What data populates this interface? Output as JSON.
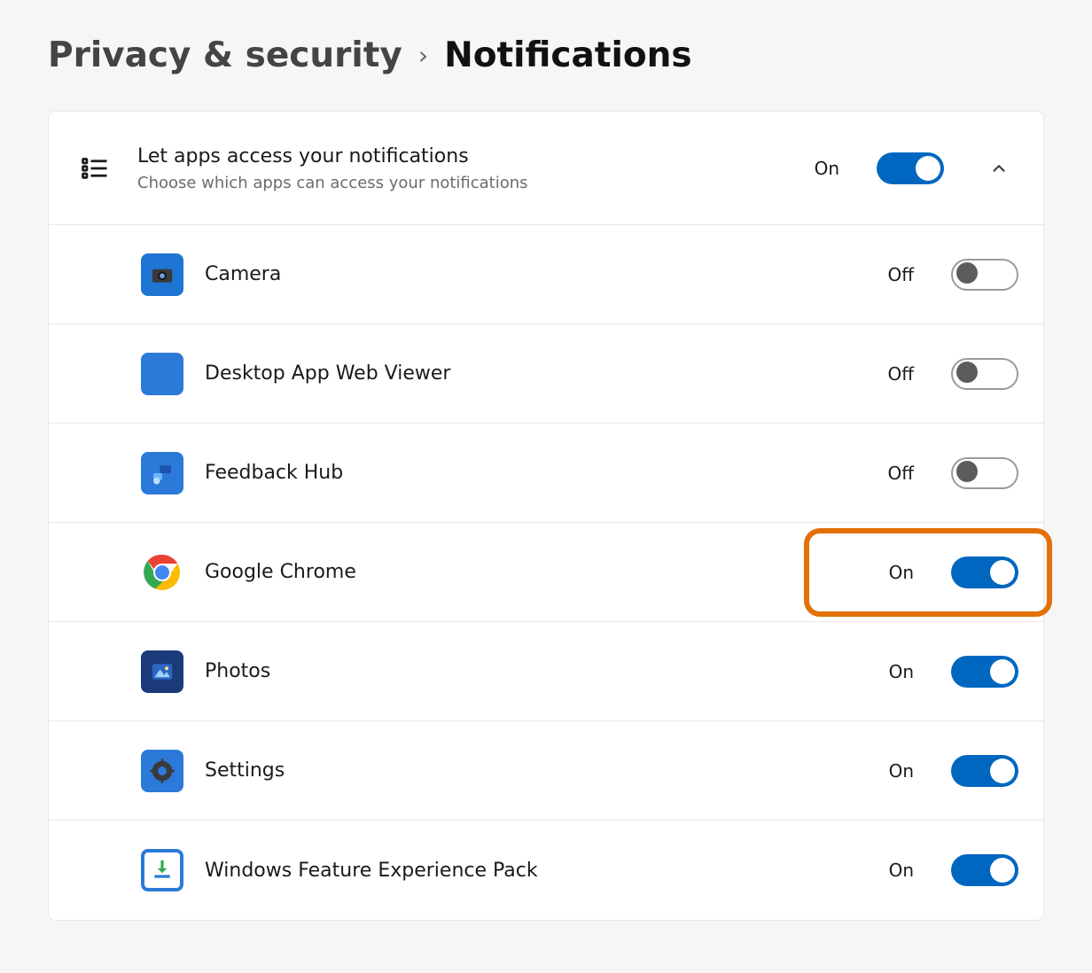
{
  "breadcrumb": {
    "parent": "Privacy & security",
    "current": "Notifications"
  },
  "section": {
    "title": "Let apps access your notifications",
    "subtitle": "Choose which apps can access your notifications",
    "state_label": "On",
    "toggle_on": true
  },
  "labels": {
    "on": "On",
    "off": "Off"
  },
  "apps": [
    {
      "name": "Camera",
      "state": "Off",
      "on": false,
      "icon": "camera"
    },
    {
      "name": "Desktop App Web Viewer",
      "state": "Off",
      "on": false,
      "icon": "blank"
    },
    {
      "name": "Feedback Hub",
      "state": "Off",
      "on": false,
      "icon": "feedback"
    },
    {
      "name": "Google Chrome",
      "state": "On",
      "on": true,
      "icon": "chrome",
      "highlighted": true
    },
    {
      "name": "Photos",
      "state": "On",
      "on": true,
      "icon": "photos"
    },
    {
      "name": "Settings",
      "state": "On",
      "on": true,
      "icon": "settings"
    },
    {
      "name": "Windows Feature Experience Pack",
      "state": "On",
      "on": true,
      "icon": "download"
    }
  ]
}
